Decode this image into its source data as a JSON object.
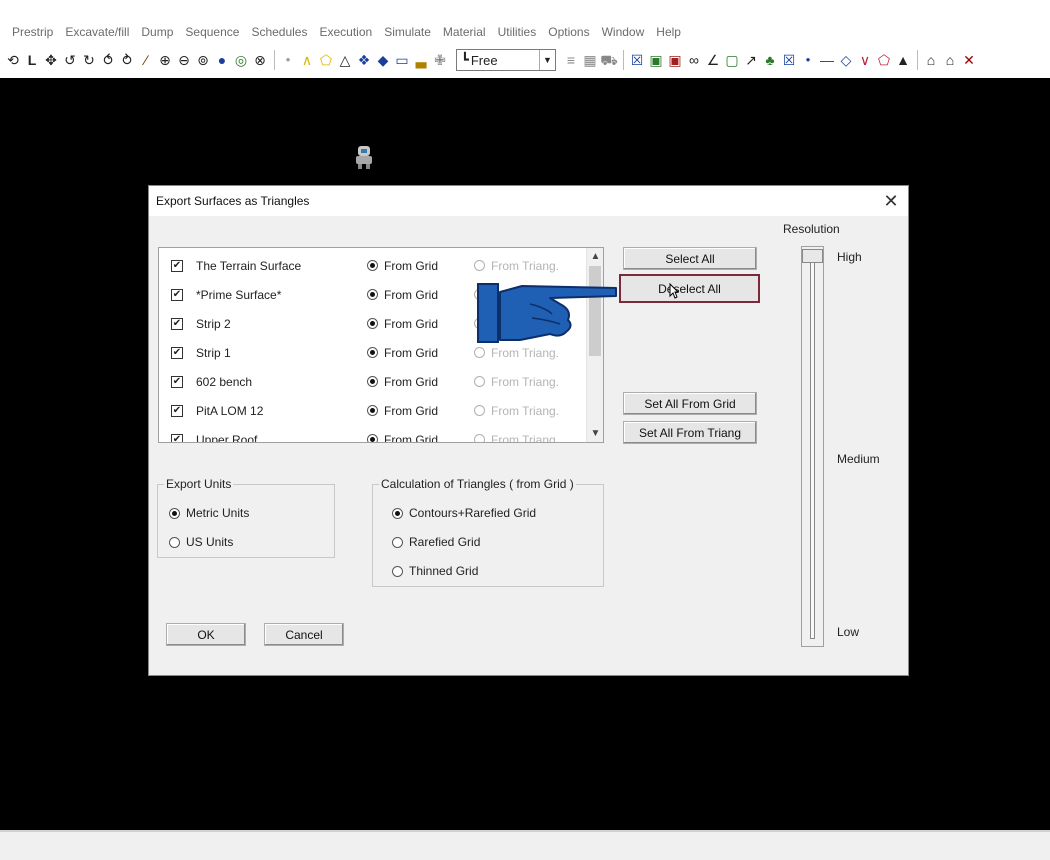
{
  "menu": [
    "Prestrip",
    "Excavate/fill",
    "Dump",
    "Sequence",
    "Schedules",
    "Execution",
    "Simulate",
    "Material",
    "Utilities",
    "Options",
    "Window",
    "Help"
  ],
  "toolbar": {
    "mode_select": "Free",
    "icons": [
      "lasso-icon",
      "axis-icon",
      "pan-icon",
      "rotate-left-icon",
      "rotate-right-icon",
      "rotate-3d-icon",
      "rotate-loop-icon",
      "pencil-icon",
      "zoom-in-icon",
      "zoom-out-icon",
      "zoom-window-icon",
      "sphere-icon",
      "zoom-target-icon",
      "zoom-extent-icon"
    ]
  },
  "dialog": {
    "title": "Export Surfaces as Triangles",
    "surfaces": [
      {
        "name": "The Terrain Surface",
        "checked": true,
        "grid_label": "From Grid",
        "triang_label": "From Triang."
      },
      {
        "name": "*Prime Surface*",
        "checked": true,
        "grid_label": "From Grid",
        "triang_label": "From Triang."
      },
      {
        "name": "Strip 2",
        "checked": true,
        "grid_label": "From Grid",
        "triang_label": "From Triang."
      },
      {
        "name": "Strip 1",
        "checked": true,
        "grid_label": "From Grid",
        "triang_label": "From Triang."
      },
      {
        "name": "602 bench",
        "checked": true,
        "grid_label": "From Grid",
        "triang_label": "From Triang."
      },
      {
        "name": "PitA  LOM 12",
        "checked": true,
        "grid_label": "From Grid",
        "triang_label": "From Triang."
      },
      {
        "name": "Upper Roof",
        "checked": true,
        "grid_label": "From Grid",
        "triang_label": "From Triang."
      }
    ],
    "buttons": {
      "select_all": "Select All",
      "deselect_all": "Deselect All",
      "set_all_grid": "Set All From Grid",
      "set_all_triang": "Set All From Triang",
      "ok": "OK",
      "cancel": "Cancel"
    },
    "export_units": {
      "title": "Export Units",
      "options": [
        "Metric Units",
        "US Units"
      ],
      "selected": "Metric Units"
    },
    "calc": {
      "title": "Calculation of Triangles ( from Grid )",
      "options": [
        "Contours+Rarefied Grid",
        "Rarefied Grid",
        "Thinned Grid"
      ],
      "selected": "Contours+Rarefied Grid"
    },
    "resolution": {
      "title": "Resolution",
      "high": "High",
      "medium": "Medium",
      "low": "Low",
      "level": 1.0
    }
  },
  "colors": {
    "canvas": "#000000",
    "focus_border": "#7a2a3a",
    "hand": "#1f5fb4"
  }
}
